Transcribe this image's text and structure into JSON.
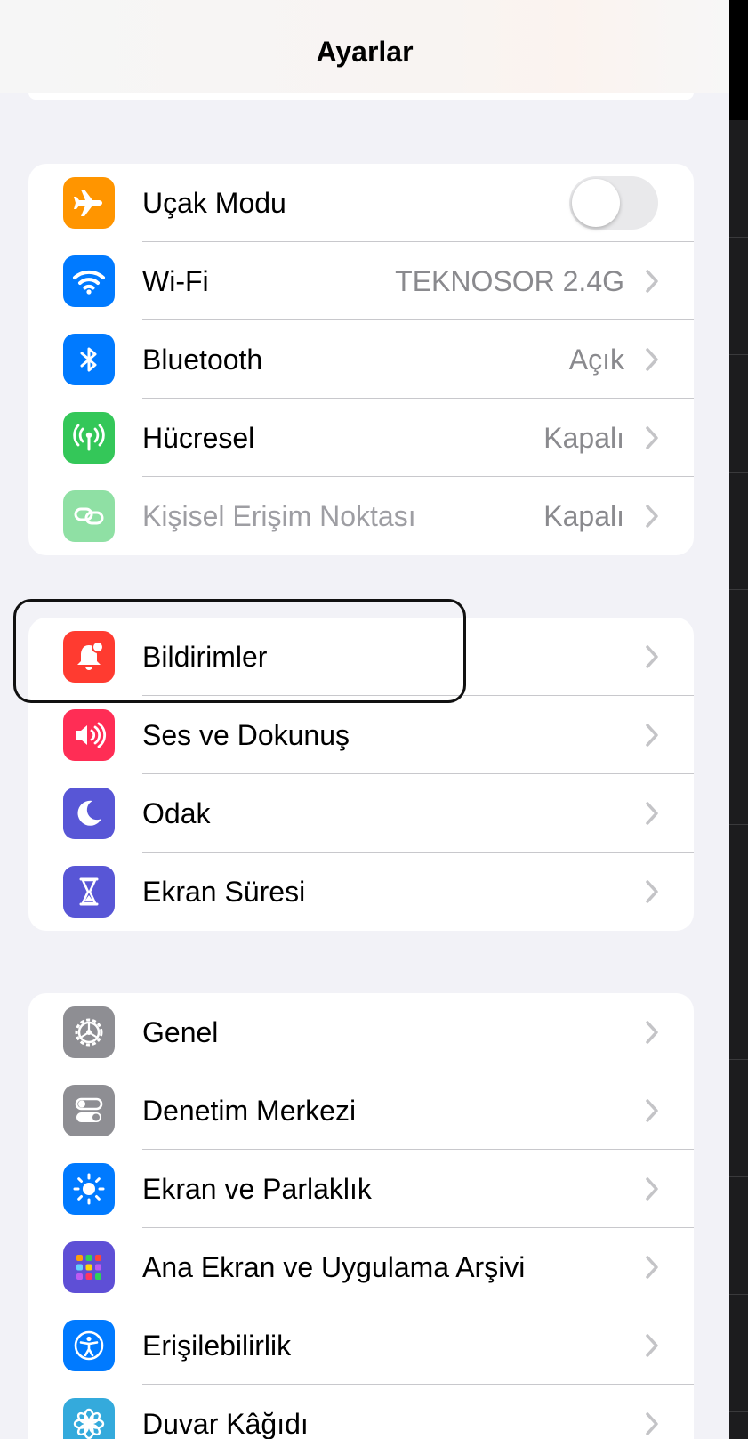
{
  "header": {
    "title": "Ayarlar"
  },
  "group1": [
    {
      "label": "Uçak Modu",
      "icon": "airplane-icon",
      "color": "#ff9500",
      "toggle": "off"
    },
    {
      "label": "Wi-Fi",
      "value": "TEKNOSOR 2.4G",
      "icon": "wifi-icon",
      "color": "#007aff"
    },
    {
      "label": "Bluetooth",
      "value": "Açık",
      "icon": "bluetooth-icon",
      "color": "#007aff"
    },
    {
      "label": "Hücresel",
      "value": "Kapalı",
      "icon": "cellular-icon",
      "color": "#34c759"
    },
    {
      "label": "Kişisel Erişim Noktası",
      "value": "Kapalı",
      "icon": "hotspot-icon",
      "color": "#34c759"
    }
  ],
  "group2": [
    {
      "label": "Bildirimler",
      "icon": "bell-icon",
      "color": "#ff3b30"
    },
    {
      "label": "Ses ve Dokunuş",
      "icon": "speaker-icon",
      "color": "#ff2d55"
    },
    {
      "label": "Odak",
      "icon": "moon-icon",
      "color": "#5856d6"
    },
    {
      "label": "Ekran Süresi",
      "icon": "hourglass-icon",
      "color": "#5856d6"
    }
  ],
  "group3": [
    {
      "label": "Genel",
      "icon": "gear-icon",
      "color": "#8e8e93"
    },
    {
      "label": "Denetim Merkezi",
      "icon": "switches-icon",
      "color": "#8e8e93"
    },
    {
      "label": "Ekran ve Parlaklık",
      "icon": "sun-icon",
      "color": "#007aff"
    },
    {
      "label": "Ana Ekran ve Uygulama Arşivi",
      "icon": "app-grid-icon",
      "color": "#5e4fd6"
    },
    {
      "label": "Erişilebilirlik",
      "icon": "accessibility-icon",
      "color": "#007aff"
    },
    {
      "label": "Duvar Kâğıdı",
      "icon": "flower-icon",
      "color": "#34aadc"
    }
  ]
}
